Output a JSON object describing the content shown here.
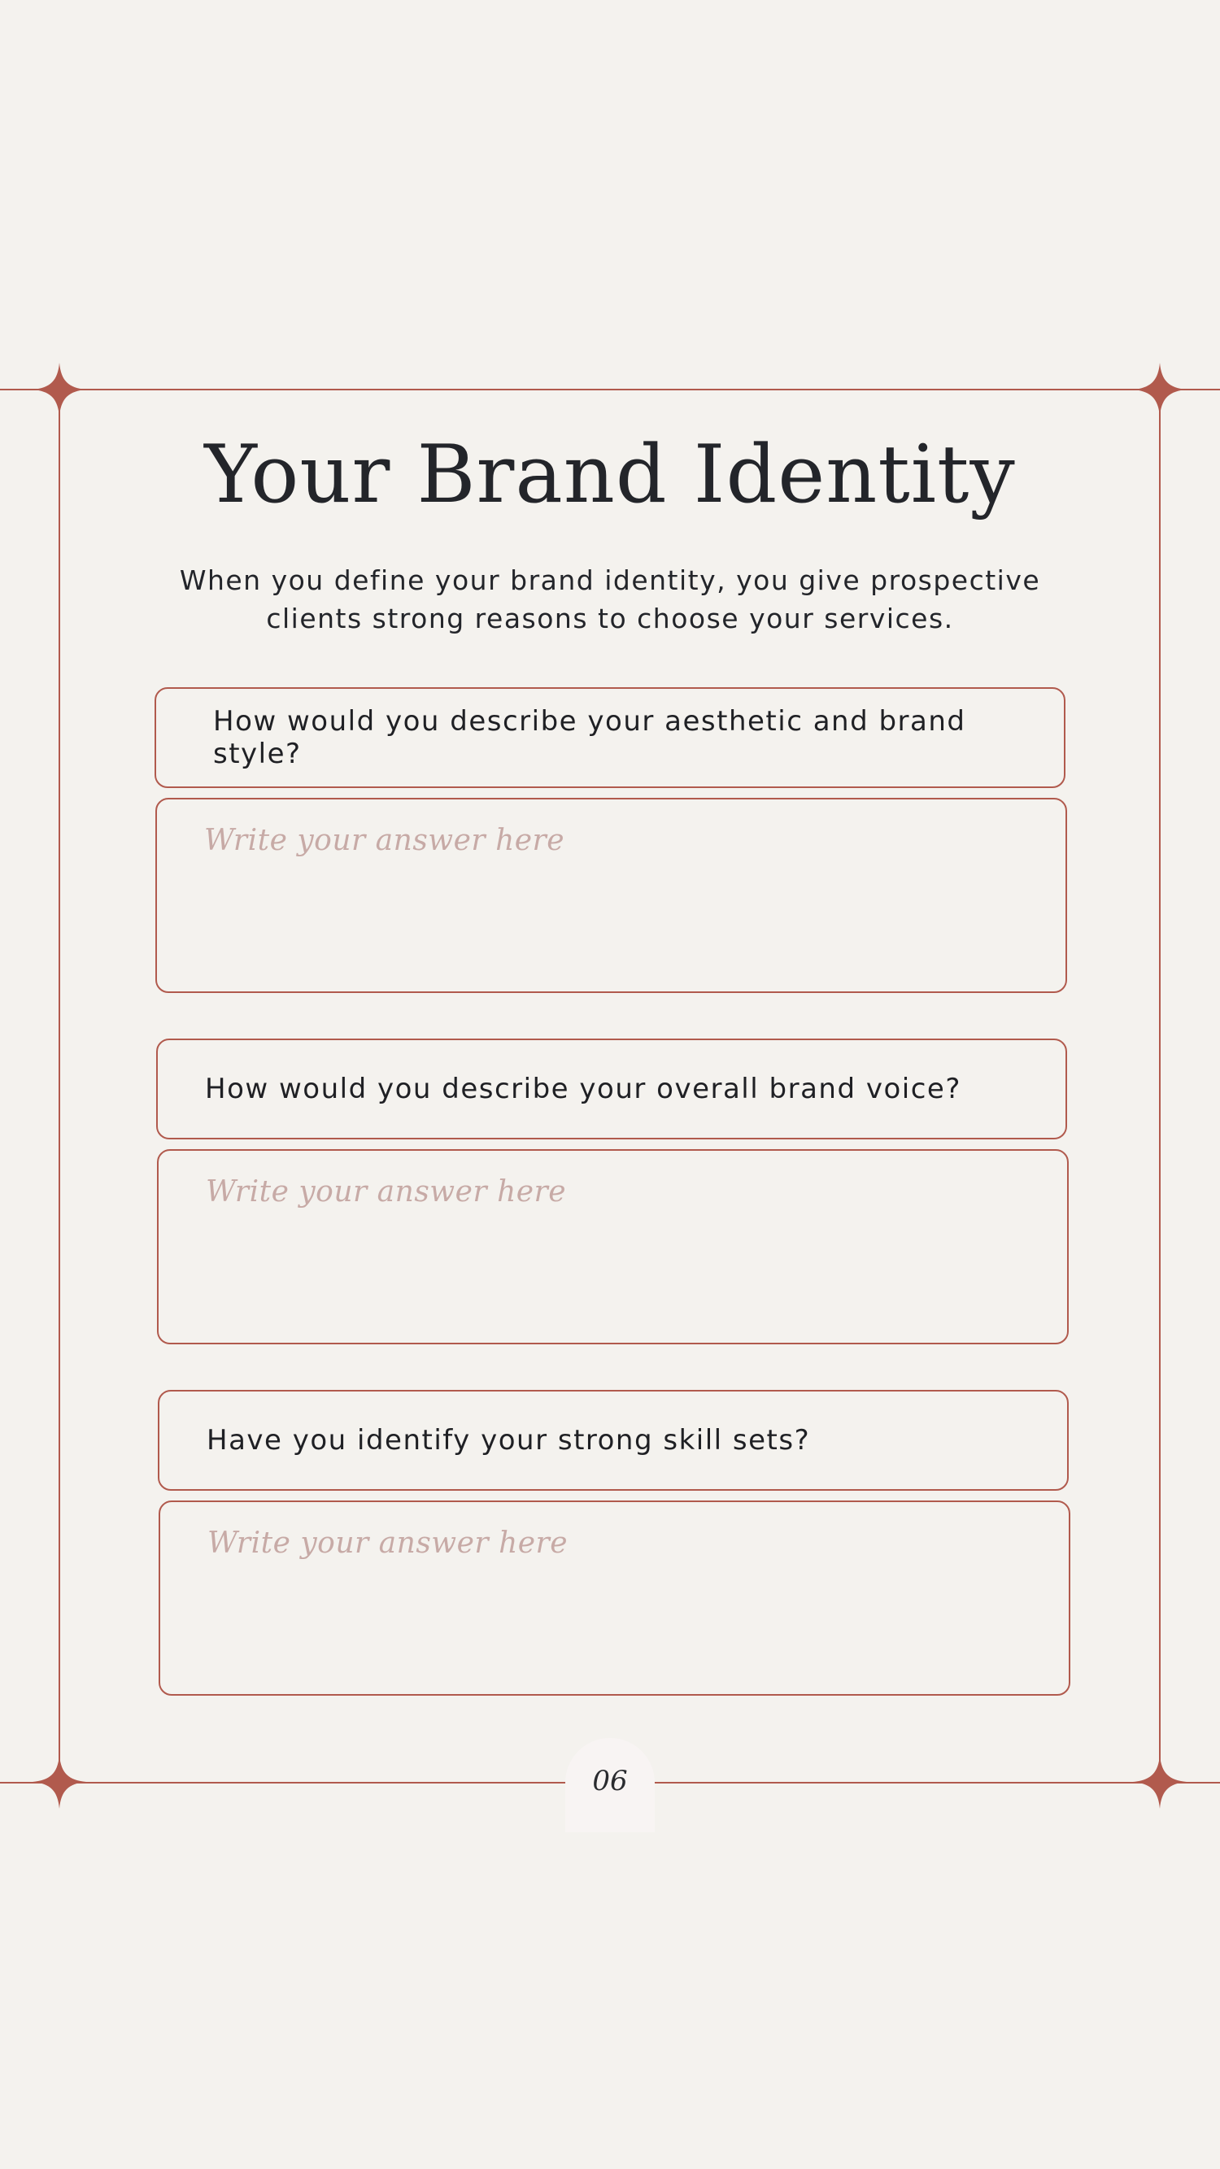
{
  "page": {
    "title": "Your Brand Identity",
    "subtitle_line1": "When you define your brand identity, you give prospective",
    "subtitle_line2": "clients strong reasons to choose your services.",
    "page_number": "06"
  },
  "questions": [
    {
      "question": "How would you describe your aesthetic and brand style?",
      "placeholder": "Write your answer here"
    },
    {
      "question": "How would you describe your overall brand voice?",
      "placeholder": "Write your answer here"
    },
    {
      "question": "Have you identify your strong skill sets?",
      "placeholder": "Write your answer here"
    }
  ],
  "colors": {
    "background": "#f4f2ee",
    "accent": "#b15a4d",
    "placeholder": "#c7aaa6",
    "text": "#1f2024"
  },
  "icons": {
    "corner": "four-point-star-icon"
  }
}
